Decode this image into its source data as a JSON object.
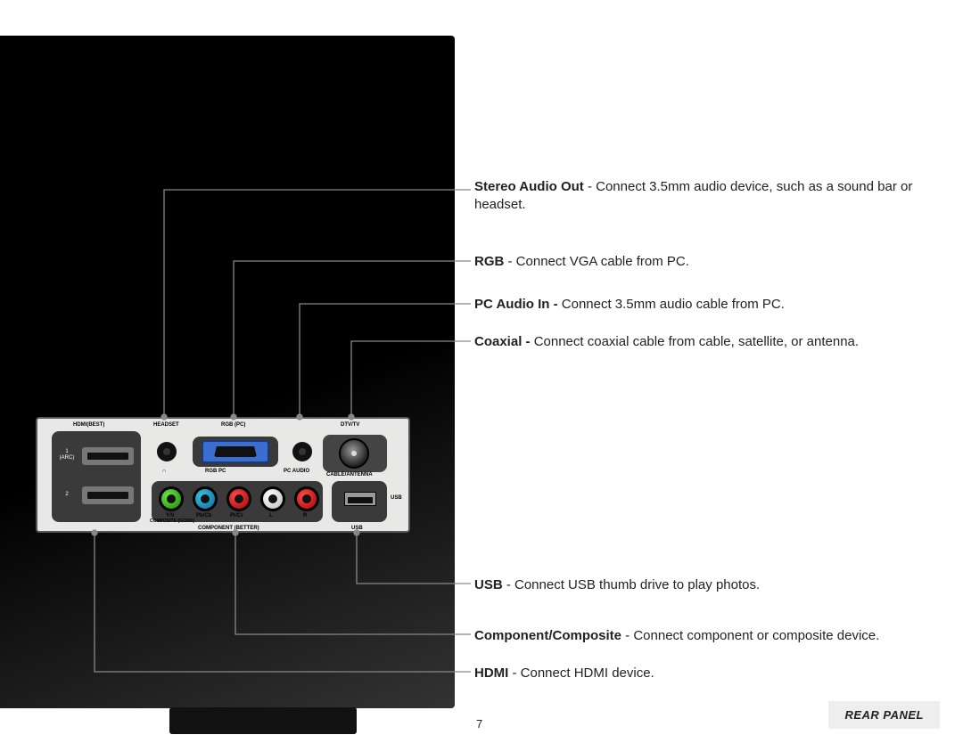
{
  "page_number": "7",
  "footer_label": "REAR PANEL",
  "descriptions": {
    "stereo": {
      "bold": "Stereo Audio Out",
      "text": " - Connect 3.5mm audio device, such as a sound bar or headset."
    },
    "rgb": {
      "bold": "RGB",
      "text": " - Connect VGA cable from PC."
    },
    "pcaudio": {
      "bold": "PC Audio In - ",
      "text": "Connect 3.5mm audio cable from PC."
    },
    "coax": {
      "bold": "Coaxial - ",
      "text": "Connect coaxial cable from cable, satellite, or antenna."
    },
    "usb": {
      "bold": "USB",
      "text": " - Connect USB thumb drive to play photos."
    },
    "comp": {
      "bold": "Component/Composite",
      "text": " - Connect component or composite device."
    },
    "hdmi": {
      "bold": "HDMI",
      "text": " - Connect HDMI device."
    }
  },
  "plate": {
    "top": {
      "hdmi": "HDMI(BEST)",
      "headset": "HEADSET",
      "rgb": "RGB (PC)",
      "dtv": "DTV/TV"
    },
    "mid": {
      "arc1": "1",
      "arc1b": "(ARC)",
      "n2": "2",
      "rgbpc": "RGB PC",
      "pcaudio": "PC AUDIO",
      "cable": "CABLE/ANTENNA",
      "usb": "USB",
      "headphone": "∩"
    },
    "bot": {
      "yv": "Y/V",
      "compositegood": "COMPOSITE (GOOD)",
      "pbcb": "Pb/Cb",
      "prcr": "Pr/Cr",
      "l": "L",
      "r": "R",
      "component": "COMPONENT (BETTER)",
      "usb": "USB"
    }
  }
}
